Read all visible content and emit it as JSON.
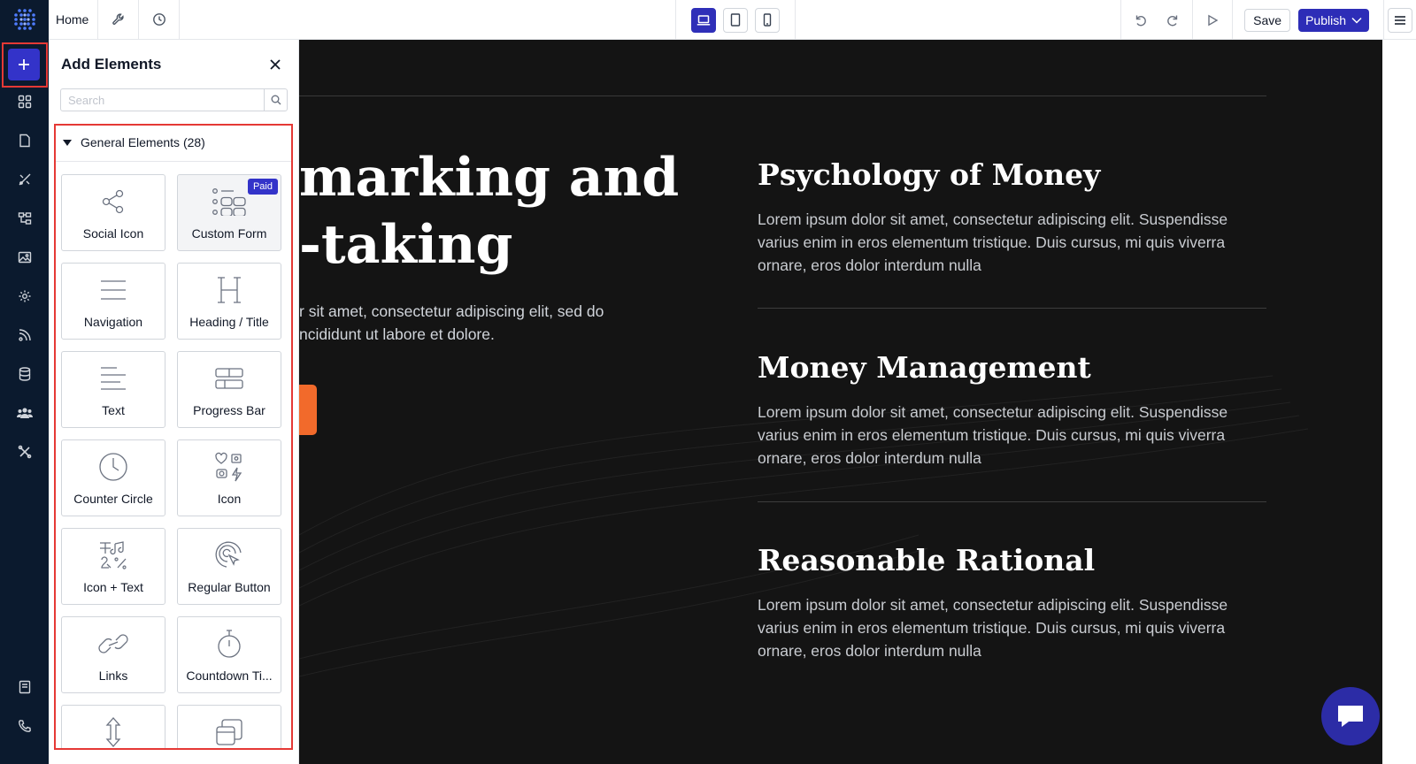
{
  "topbar": {
    "page_name": "Home",
    "save_label": "Save",
    "publish_label": "Publish"
  },
  "panel": {
    "title": "Add Elements",
    "search_placeholder": "Search",
    "category_label": "General Elements (28)",
    "elements": [
      {
        "label": "Social Icon",
        "icon": "share-icon"
      },
      {
        "label": "Custom Form",
        "icon": "form-icon",
        "badge": "Paid"
      },
      {
        "label": "Navigation",
        "icon": "menu-lines-icon"
      },
      {
        "label": "Heading / Title",
        "icon": "heading-h-icon"
      },
      {
        "label": "Text",
        "icon": "text-lines-icon"
      },
      {
        "label": "Progress Bar",
        "icon": "progress-bar-icon"
      },
      {
        "label": "Counter Circle",
        "icon": "clock-circle-icon"
      },
      {
        "label": "Icon",
        "icon": "icon-shapes-icon"
      },
      {
        "label": "Icon + Text",
        "icon": "icon-text-icon"
      },
      {
        "label": "Regular Button",
        "icon": "target-button-icon"
      },
      {
        "label": "Links",
        "icon": "link-chain-icon"
      },
      {
        "label": "Countdown Ti...",
        "icon": "stopwatch-icon"
      },
      {
        "label": "",
        "icon": "vertical-arrows-icon"
      },
      {
        "label": "",
        "icon": "layers-icon"
      }
    ]
  },
  "canvas": {
    "hero_line1": "marking and",
    "hero_line2": "-taking",
    "hero_text": "r sit amet, consectetur adipiscing elit, sed do ncididunt ut labore et dolore.",
    "features": [
      {
        "title": "Psychology of Money",
        "text": "Lorem ipsum dolor sit amet, consectetur adipiscing elit. Suspendisse varius enim in eros elementum tristique. Duis cursus, mi quis viverra ornare, eros dolor interdum nulla"
      },
      {
        "title": "Money Management",
        "text": "Lorem ipsum dolor sit amet, consectetur adipiscing elit. Suspendisse varius enim in eros elementum tristique. Duis cursus, mi quis viverra ornare, eros dolor interdum nulla"
      },
      {
        "title": "Reasonable Rational",
        "text": "Lorem ipsum dolor sit amet, consectetur adipiscing elit. Suspendisse varius enim in eros elementum tristique. Duis cursus, mi quis viverra ornare, eros dolor interdum nulla"
      }
    ]
  },
  "colors": {
    "brand_blue": "#3333c9",
    "rail_bg": "#0b1a2e",
    "canvas_bg": "#141414",
    "highlight_red": "#e53935",
    "cta_orange": "#f26a2b"
  }
}
